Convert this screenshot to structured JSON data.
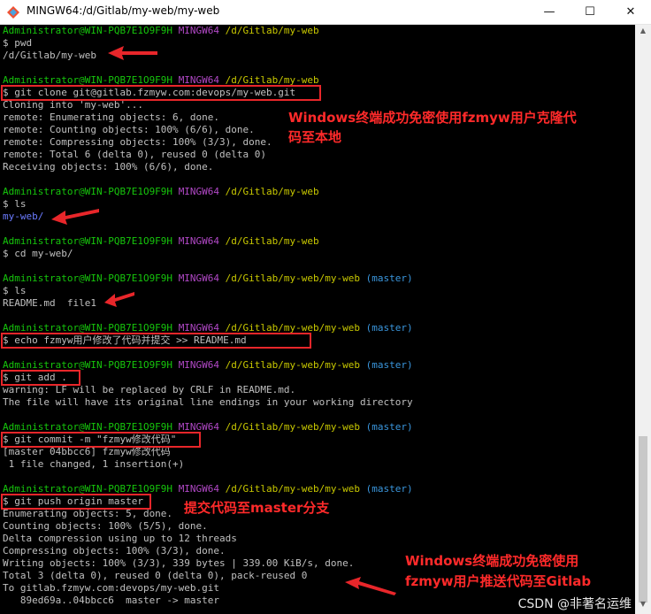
{
  "window": {
    "title": "MINGW64:/d/Gitlab/my-web/my-web",
    "min": "—",
    "max": "☐",
    "close": "✕"
  },
  "prompts": {
    "user": "Administrator@WIN-PQB7E1O9F9H",
    "shell": "MINGW64",
    "path1": "/d/Gitlab/my-web",
    "path2": "/d/Gitlab/my-web/my-web",
    "branch": "(master)"
  },
  "lines": {
    "pwd": "$ pwd",
    "pwd_out": "/d/Gitlab/my-web",
    "clone": "$ git clone git@gitlab.fzmyw.com:devops/my-web.git",
    "clone_o1": "Cloning into 'my-web'...",
    "clone_o2": "remote: Enumerating objects: 6, done.",
    "clone_o3": "remote: Counting objects: 100% (6/6), done.",
    "clone_o4": "remote: Compressing objects: 100% (3/3), done.",
    "clone_o5": "remote: Total 6 (delta 0), reused 0 (delta 0)",
    "clone_o6": "Receiving objects: 100% (6/6), done.",
    "ls1": "$ ls",
    "ls1_out": "my-web/",
    "cd": "$ cd my-web/",
    "ls2": "$ ls",
    "ls2_out": "README.md  file1",
    "echo": "$ echo fzmyw用户修改了代码并提交 >> README.md",
    "add": "$ git add .",
    "add_o1": "warning: LF will be replaced by CRLF in README.md.",
    "add_o2": "The file will have its original line endings in your working directory",
    "commit": "$ git commit -m \"fzmyw修改代码\"",
    "commit_o1": "[master 04bbcc6] fzmyw修改代码",
    "commit_o2": " 1 file changed, 1 insertion(+)",
    "push": "$ git push origin master",
    "push_o1": "Enumerating objects: 5, done.",
    "push_o2": "Counting objects: 100% (5/5), done.",
    "push_o3": "Delta compression using up to 12 threads",
    "push_o4": "Compressing objects: 100% (3/3), done.",
    "push_o5": "Writing objects: 100% (3/3), 339 bytes | 339.00 KiB/s, done.",
    "push_o6": "Total 3 (delta 0), reused 0 (delta 0), pack-reused 0",
    "push_o7": "To gitlab.fzmyw.com:devops/my-web.git",
    "push_o8": "   89ed69a..04bbcc6  master -> master"
  },
  "annotations": {
    "clone_note_1": "Windows终端成功免密使用fzmyw用户克隆代",
    "clone_note_2": "码至本地",
    "push_note": "提交代码至master分支",
    "result_note_1": "Windows终端成功免密使用",
    "result_note_2": "fzmyw用户推送代码至Gitlab"
  },
  "watermark": "CSDN @非著名运维",
  "colors": {
    "prompt_user": "#16c60c",
    "prompt_shell": "#b148c6",
    "prompt_path": "#c8c800",
    "branch": "#3a96dd",
    "annotation": "#ff2a2a"
  }
}
